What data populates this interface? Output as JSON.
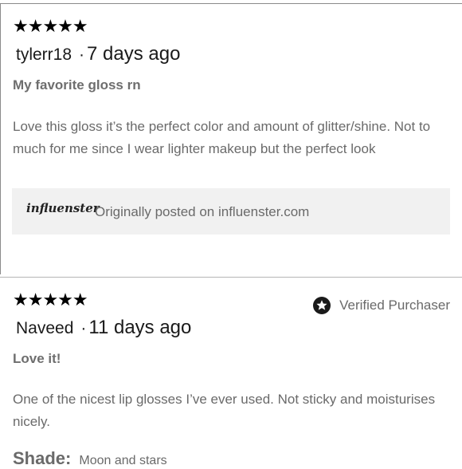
{
  "reviews": [
    {
      "rating": "★★★★★",
      "author": "tylerr18",
      "separator": "·",
      "date": "7 days ago",
      "title": "My favorite gloss rn",
      "body": "Love this gloss it’s the perfect color and amount of glitter/shine. Not to much for me since I wear lighter makeup but the perfect look",
      "source": {
        "logo": "influenster",
        "text": "Originally posted on influenster.com"
      }
    },
    {
      "rating": "★★★★★",
      "author": "Naveed",
      "separator": "·",
      "date": "11 days ago",
      "verified": {
        "icon": "verified-star-icon",
        "label": "Verified Purchaser"
      },
      "title": "Love it!",
      "body": "One of the nicest lip glosses I’ve ever used. Not sticky and moisturises nicely.",
      "shade": {
        "label": "Shade:",
        "value": "Moon and stars"
      }
    }
  ],
  "colors": {
    "text_primary": "#1a1a1a",
    "text_secondary": "#6a6a6a",
    "source_box_bg": "#f1f1f1",
    "stars": "#000000"
  }
}
